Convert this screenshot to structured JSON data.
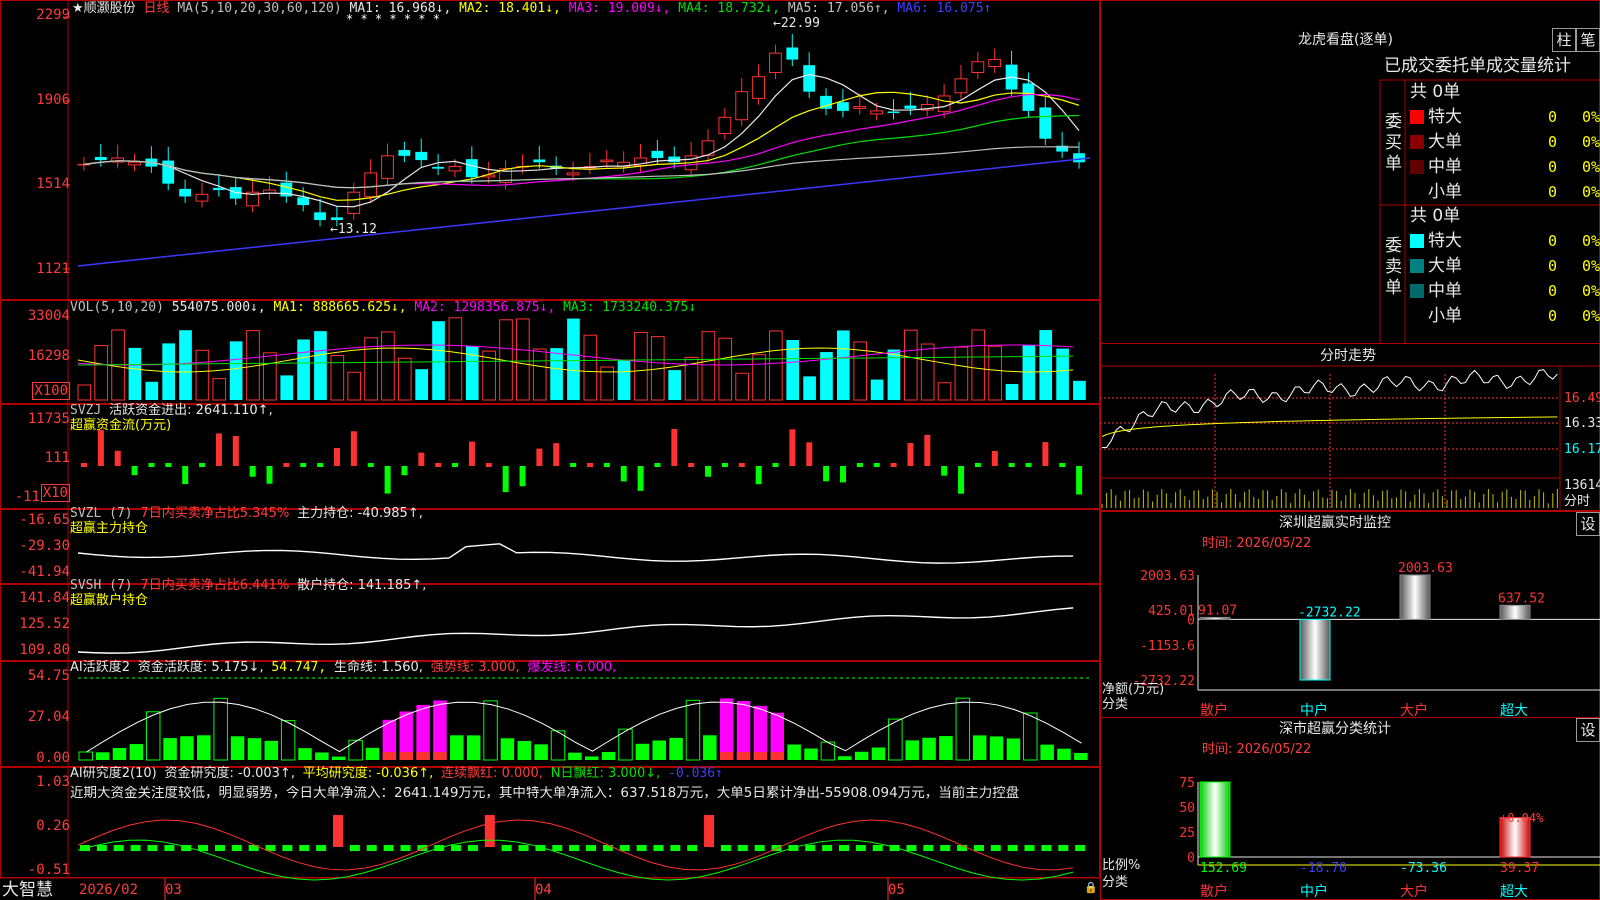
{
  "header": {
    "stock_name": "★顺灏股份",
    "period": "日线",
    "ma_params": "MA(5,10,20,30,60,120)",
    "stars": "* * * * * * *",
    "ma1": "MA1: 16.968↓,",
    "ma2": "MA2: 18.401↓,",
    "ma3": "MA3: 19.009↓,",
    "ma4": "MA4: 18.732↓,",
    "ma5": "MA5: 17.056↑,",
    "ma6": "MA6: 16.075↑"
  },
  "price_axis": {
    "ticks": [
      "2299",
      "1906",
      "1514",
      "1121"
    ],
    "high_label": "←22.99",
    "low_label": "←13.12"
  },
  "vol": {
    "title": "VOL(5,10,20)",
    "value": "554075.000↓,",
    "ma1": "MA1: 888665.625↓,",
    "ma2": "MA2: 1298356.875↓,",
    "ma3": "MA3: 1733240.375↓",
    "ticks": [
      "33004",
      "16298",
      "X100"
    ]
  },
  "svzj": {
    "title": "SVZJ",
    "line1": "活跃资金进出: 2641.110↑,",
    "line2": "超赢资金流(万元)",
    "ticks": [
      "11735",
      "111",
      "-11",
      "X10"
    ]
  },
  "svzl": {
    "title": "SVZL (7)",
    "pct": "7日内买卖净占比5.345%",
    "value": "主力持仓: -40.985↑,",
    "line2": "超赢主力持仓",
    "ticks": [
      "-16.65",
      "-29.30",
      "-41.94"
    ]
  },
  "svsh": {
    "title": "SVSH (7)",
    "pct": "7日内买卖净占比6.441%",
    "value": "散户持仓: 141.185↑,",
    "line2": "超赢散户持仓",
    "ticks": [
      "141.84",
      "125.52",
      "109.80"
    ]
  },
  "ai1": {
    "title": "AI活跃度2",
    "v1": "资金活跃度: 5.175↓,",
    "v2": "54.747,",
    "v3": "生命线: 1.560,",
    "v4": "强势线: 3.000,",
    "v5": "爆发线: 6.000,",
    "ticks": [
      "54.75",
      "27.04",
      "0.00"
    ]
  },
  "ai2": {
    "title": "AI研究度2(10)",
    "v1": "资金研究度: -0.003↑,",
    "v2": "平均研究度: -0.036↑,",
    "v3": "连续飘红: 0.000,",
    "v4": "N日飘红: 3.000↓,",
    "v5": "-0.036↑",
    "comment": "近期大资金关注度较低，明显弱势，今日大单净流入：2641.149万元，其中特大单净流入：637.518万元，大单5日累计净出-55908.094万元，当前主力控盘",
    "ticks": [
      "1.03",
      "0.26",
      "-0.51"
    ]
  },
  "footer": {
    "logo": "大智慧",
    "dates": [
      "2026/02",
      "03",
      "04",
      "05"
    ]
  },
  "right": {
    "dragon_title": "龙虎看盘(逐单)",
    "btn1": "柱",
    "btn2": "笔",
    "table_title": "已成交委托单成交量统计",
    "buy_label": "委买单",
    "sell_label": "委卖单",
    "buy_total": "共 0单",
    "sell_total": "共 0单",
    "buy_rows": [
      {
        "name": "特大",
        "count": "0",
        "pct": "0%",
        "color": "#ff0000"
      },
      {
        "name": "大单",
        "count": "0",
        "pct": "0%",
        "color": "#8b0000"
      },
      {
        "name": "中单",
        "count": "0",
        "pct": "0%",
        "color": "#600000"
      },
      {
        "name": "小单",
        "count": "0",
        "pct": "0%",
        "color": ""
      }
    ],
    "sell_rows": [
      {
        "name": "特大",
        "count": "0",
        "pct": "0%",
        "color": "#00ffff"
      },
      {
        "name": "大单",
        "count": "0",
        "pct": "0%",
        "color": "#008080"
      },
      {
        "name": "中单",
        "count": "0",
        "pct": "0%",
        "color": "#006a6a"
      },
      {
        "name": "小单",
        "count": "0",
        "pct": "0%",
        "color": ""
      }
    ],
    "intraday_title": "分时走势",
    "intraday_ticks": [
      "16.49",
      "16.33",
      "16.17"
    ],
    "intraday_vol": "13614",
    "intraday_bottom": "分时",
    "monitor_title": "深圳超赢实时监控",
    "monitor_btn": "设",
    "monitor_time": "时间: 2026/05/22",
    "monitor_ticks": [
      "2003.63",
      "425.01",
      "0",
      "-1153.6",
      "-2732.22"
    ],
    "monitor_ylabel": "净额(万元)",
    "monitor_xlabel": "分类",
    "stats_title": "深市超赢分类统计",
    "stats_btn": "设",
    "stats_time": "时间: 2026/05/22",
    "stats_ticks": [
      "75",
      "50",
      "25",
      "0"
    ],
    "stats_ylabel": "比例%",
    "stats_xlabel": "分类",
    "stats_annot": "+0.04%"
  },
  "chart_data": [
    {
      "type": "bar",
      "title": "深圳超赢实时监控",
      "categories": [
        "散户",
        "中户",
        "大户",
        "超大"
      ],
      "values": [
        91.07,
        -2732.22,
        2003.63,
        637.52
      ],
      "value_labels": [
        "91.07",
        "-2732.22",
        "2003.63",
        "637.52"
      ],
      "ylabel": "净额(万元)",
      "xlabel": "分类",
      "ylim": [
        -2732.22,
        2003.63
      ]
    },
    {
      "type": "bar",
      "title": "深市超赢分类统计",
      "categories": [
        "散户",
        "中户",
        "大户",
        "超大"
      ],
      "values": [
        152.69,
        -18.7,
        -73.36,
        39.37
      ],
      "value_labels": [
        "152.69",
        "-18.70",
        "-73.36",
        "39.37"
      ],
      "ylabel": "比例%",
      "xlabel": "分类",
      "ylim": [
        0,
        75
      ]
    }
  ]
}
